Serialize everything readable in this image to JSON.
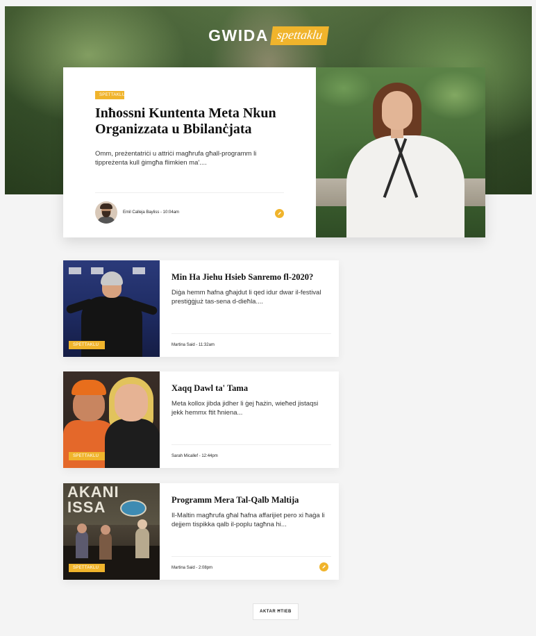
{
  "header": {
    "brand": "GWIDA",
    "brand_tag": "spettaklu"
  },
  "featured": {
    "category": "SPETTAKLU",
    "title": "Inħossni Kuntenta Meta Nkun Organizzata u Bbilanċjata",
    "excerpt": "Omm, preżentatriċi u attriċi magħrufa għall-programm li tippreżenta kull ġimgħa flimkien ma'....",
    "byline": "Emil Calleja Bayliss - 10:04am",
    "share_icon": "pencil-icon"
  },
  "articles": [
    {
      "category": "SPETTAKLU",
      "title": "Min Ha Jiehu Hsieb Sanremo fl-2020?",
      "excerpt": "Diġa hemm ħafna għajdut li qed idur dwar il-festival prestiġġjuż tas-sena d-dieħla....",
      "meta": "Martina Said - 11:32am"
    },
    {
      "category": "SPETTAKLU",
      "title": "Xaqq Dawl ta' Tama",
      "excerpt": "Meta kollox jibda jidher li ġej ħażin, wieħed jistaqsi jekk hemmx ftit ħniena...",
      "meta": "Sarah Micallef - 12:44pm"
    },
    {
      "category": "SPETTAKLU",
      "title": "Programm Mera Tal-Qalb Maltija",
      "excerpt": "Il-Maltin magħrufa għal ħafna affarijiet pero xi ħaġa li dejjem tispikka qalb il-poplu tagħna hi...",
      "meta": "Martina Said - 2:08pm",
      "has_share": true
    }
  ],
  "thumb3_poster": "AKANI ISSA",
  "load_more": "AKTAR ĦTIEB",
  "colors": {
    "accent": "#f0b42c",
    "card": "#ffffff",
    "page": "#f4f4f4"
  }
}
